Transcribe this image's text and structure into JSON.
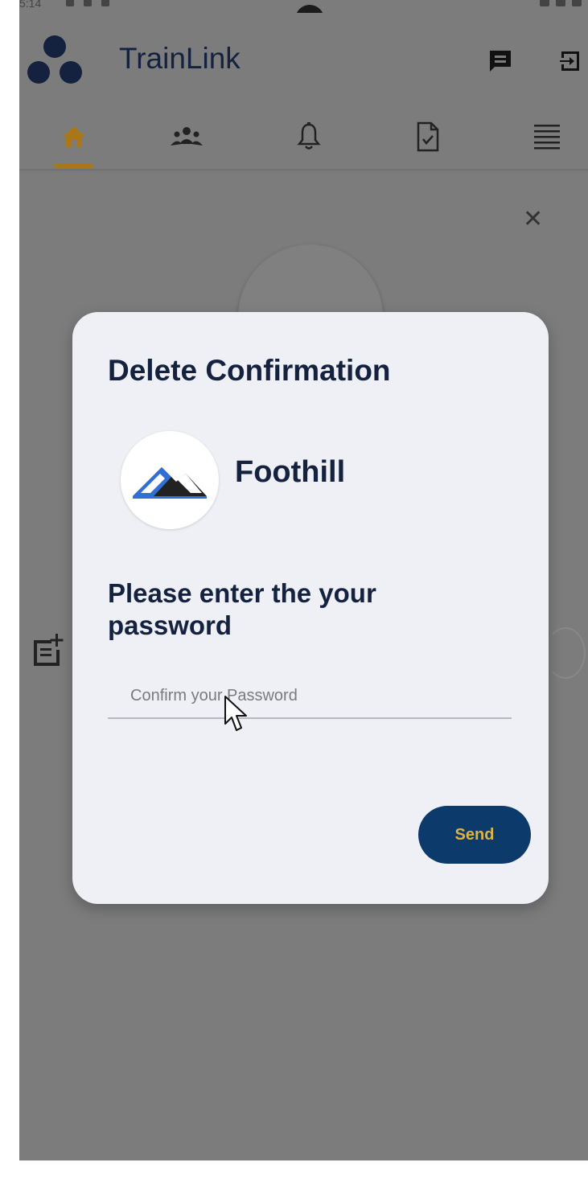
{
  "app": {
    "title": "TrainLink"
  },
  "statusbar": {
    "time": "5:14"
  },
  "tabs": [
    {
      "name": "home",
      "icon": "home-icon",
      "active": true
    },
    {
      "name": "people",
      "icon": "people-icon",
      "active": false
    },
    {
      "name": "notifications",
      "icon": "bell-icon",
      "active": false
    },
    {
      "name": "documents",
      "icon": "document-check-icon",
      "active": false
    },
    {
      "name": "menu",
      "icon": "menu-icon",
      "active": false
    }
  ],
  "dialog": {
    "title": "Delete Confirmation",
    "org_name": "Foothill",
    "prompt": "Please enter the your password",
    "password_placeholder": "Confirm your Password",
    "password_value": "",
    "send_label": "Send"
  },
  "colors": {
    "accent": "#a8771a",
    "primary": "#0c3a6b",
    "send_text": "#e0b43e",
    "title_text": "#14223f"
  }
}
